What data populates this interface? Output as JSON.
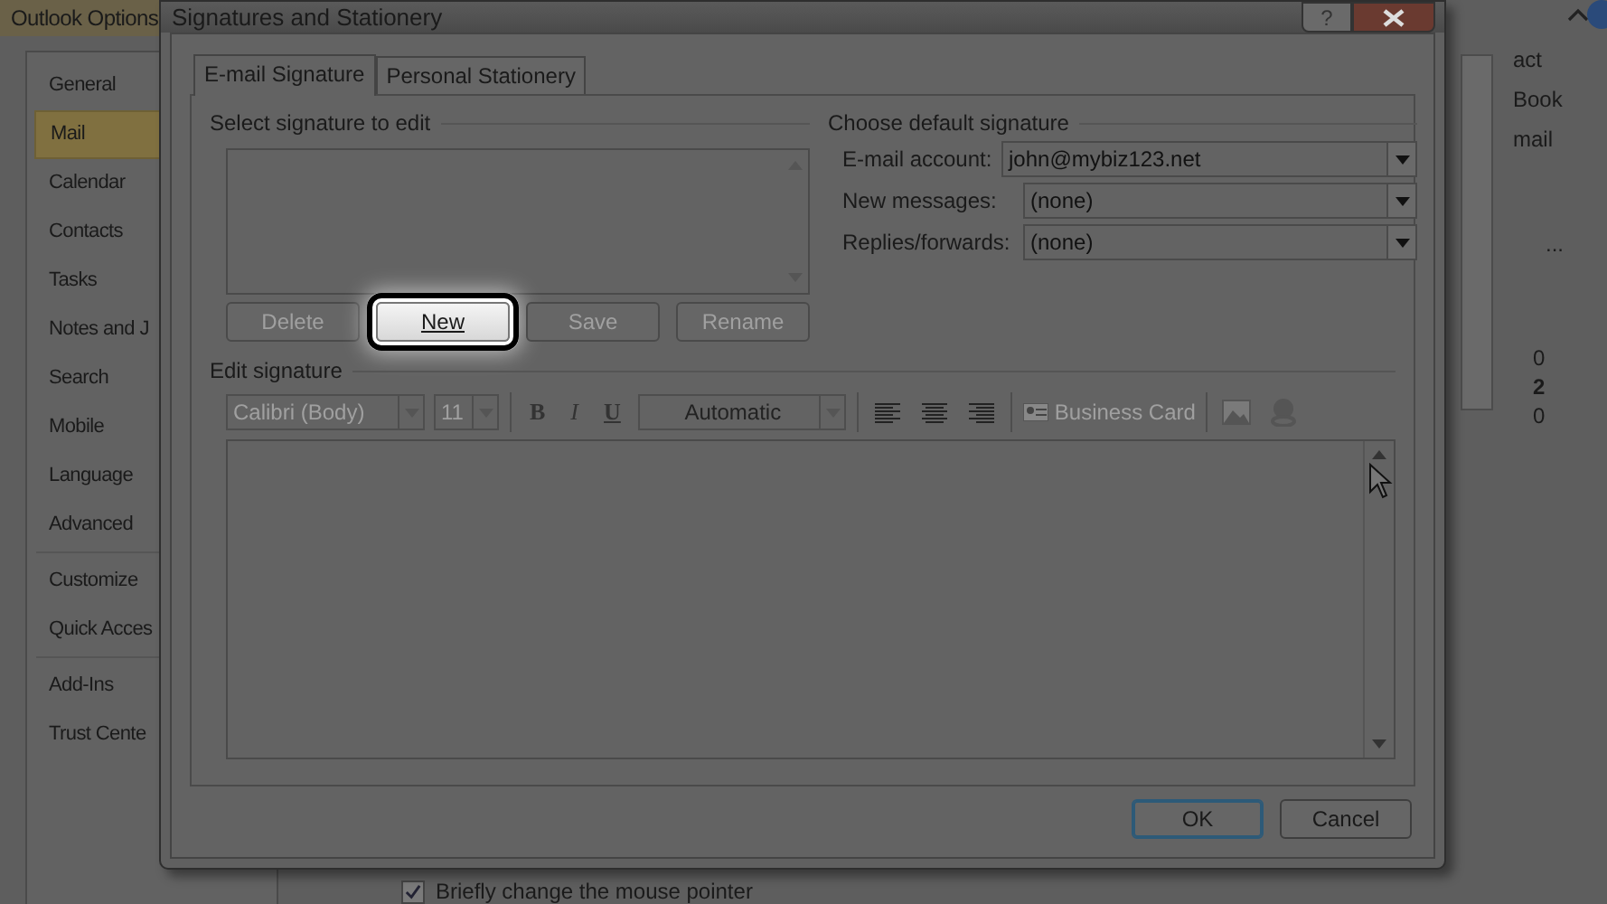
{
  "options_window": {
    "title": "Outlook Options",
    "nav_groups": [
      [
        {
          "label": "General",
          "selected": false
        },
        {
          "label": "Mail",
          "selected": true
        },
        {
          "label": "Calendar",
          "selected": false
        },
        {
          "label": "Contacts",
          "selected": false
        },
        {
          "label": "Tasks",
          "selected": false
        },
        {
          "label": "Notes and J",
          "selected": false
        },
        {
          "label": "Search",
          "selected": false
        },
        {
          "label": "Mobile",
          "selected": false
        },
        {
          "label": "Language",
          "selected": false
        },
        {
          "label": "Advanced",
          "selected": false
        }
      ],
      [
        {
          "label": "Customize",
          "selected": false
        },
        {
          "label": "Quick Acces",
          "selected": false
        }
      ],
      [
        {
          "label": "Add-Ins",
          "selected": false
        },
        {
          "label": "Trust Cente",
          "selected": false
        }
      ]
    ],
    "ribbon_items": [
      "act",
      "Book",
      "mail"
    ],
    "list_header": "...",
    "counts": [
      {
        "text": "0",
        "bold": false
      },
      {
        "text": "2",
        "bold": true
      },
      {
        "text": "0",
        "bold": false
      }
    ],
    "checkbox": {
      "label": "Briefly change the mouse pointer",
      "checked": true
    }
  },
  "dialog": {
    "title": "Signatures and Stationery",
    "help": "?",
    "tabs": [
      {
        "label": "E-mail Signature",
        "selected": true
      },
      {
        "label": "Personal Stationery",
        "selected": false
      }
    ],
    "select_title": "Select signature to edit",
    "sig_buttons": [
      {
        "label": "Delete",
        "disabled": true,
        "highlighted": false
      },
      {
        "label": "New",
        "disabled": false,
        "highlighted": true
      },
      {
        "label": "Save",
        "disabled": true,
        "highlighted": false
      },
      {
        "label": "Rename",
        "disabled": true,
        "highlighted": false
      }
    ],
    "default_title": "Choose default signature",
    "default_fields": [
      {
        "label": "E-mail account:",
        "value": "john@mybiz123.net"
      },
      {
        "label": "New messages:",
        "value": "(none)"
      },
      {
        "label": "Replies/forwards:",
        "value": "(none)"
      }
    ],
    "edit_title": "Edit signature",
    "toolbar": {
      "font": "Calibri (Body)",
      "size": "11",
      "bold": "B",
      "italic": "I",
      "underline": "U",
      "color_picker": "Automatic",
      "business_card": "Business Card"
    },
    "buttons": [
      {
        "label": "OK",
        "default": true
      },
      {
        "label": "Cancel",
        "default": false
      }
    ]
  }
}
